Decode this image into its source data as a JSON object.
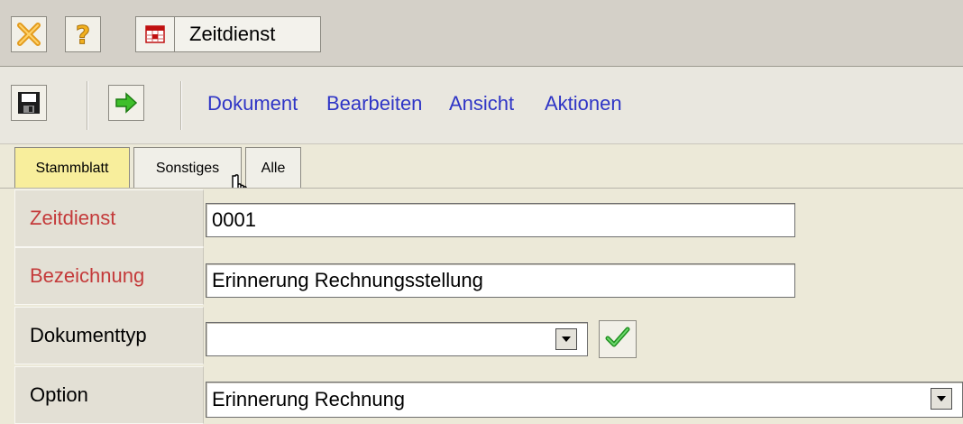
{
  "window": {
    "title": "Zeitdienst",
    "icons": {
      "close": "close-icon",
      "help": "help-icon",
      "title": "table-icon"
    }
  },
  "toolbar": {
    "icons": {
      "save": "save-icon",
      "forward": "arrow-right-icon"
    },
    "menu": [
      "Dokument",
      "Bearbeiten",
      "Ansicht",
      "Aktionen"
    ]
  },
  "tabs": [
    {
      "label": "Stammblatt",
      "active": true
    },
    {
      "label": "Sonstiges",
      "active": false
    },
    {
      "label": "Alle",
      "active": false
    }
  ],
  "form": {
    "fields": [
      {
        "label": "Zeitdienst",
        "value": "0001",
        "required": true
      },
      {
        "label": "Bezeichnung",
        "value": "Erinnerung Rechnungsstellung",
        "required": true
      },
      {
        "label": "Dokumenttyp",
        "value": "",
        "required": false
      },
      {
        "label": "Option",
        "value": "Erinnerung Rechnung",
        "required": false
      }
    ]
  },
  "colors": {
    "menu_link": "#2f35c6",
    "required_label": "#c43a3a",
    "active_tab": "#f8ee9c"
  }
}
